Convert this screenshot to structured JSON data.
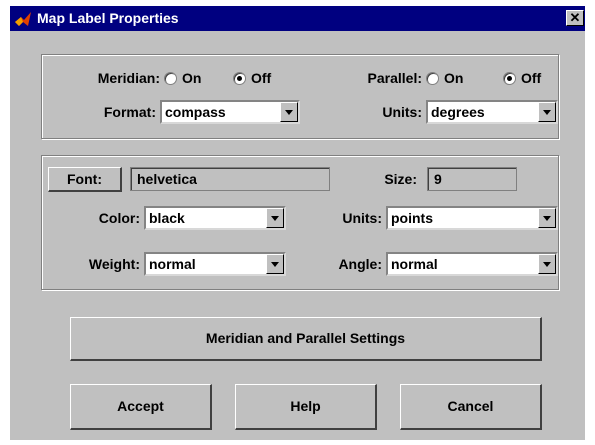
{
  "window": {
    "title": "Map Label Properties"
  },
  "grid_group": {
    "meridian_label": "Meridian:",
    "meridian_on": "On",
    "meridian_off": "Off",
    "meridian_selected": "Off",
    "parallel_label": "Parallel:",
    "parallel_on": "On",
    "parallel_off": "Off",
    "parallel_selected": "Off",
    "format_label": "Format:",
    "format_value": "compass",
    "units_label": "Units:",
    "units_value": "degrees"
  },
  "font_group": {
    "font_button": "Font:",
    "font_name": "helvetica",
    "size_label": "Size:",
    "size_value": "9",
    "color_label": "Color:",
    "color_value": "black",
    "units_label": "Units:",
    "units_value": "points",
    "weight_label": "Weight:",
    "weight_value": "normal",
    "angle_label": "Angle:",
    "angle_value": "normal"
  },
  "buttons": {
    "settings": "Meridian and Parallel Settings",
    "accept": "Accept",
    "help": "Help",
    "cancel": "Cancel"
  },
  "icons": {
    "app": "matlab-logo-icon",
    "close": "close-icon"
  },
  "colors": {
    "titlebar": "#000080",
    "face": "#c0c0c0"
  }
}
